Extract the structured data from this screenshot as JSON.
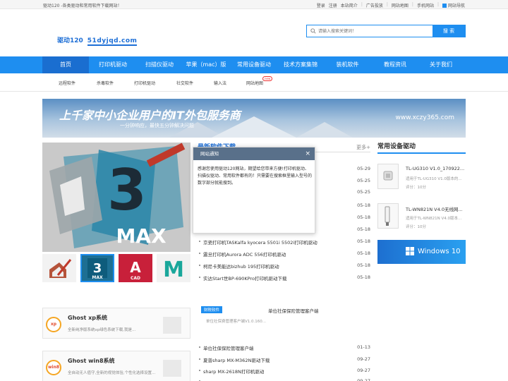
{
  "topbar": {
    "slogan": "驱动120 -各类驱动和常用软件下载网站！",
    "login": "登录",
    "register": "注册",
    "about": "本站简介",
    "ads": "广告投放",
    "sitemap": "网站地图",
    "mobile": "手机网站",
    "site_nav": "网站导航"
  },
  "logo": {
    "cn": "驱动120",
    "domain": "51dyjqd.com"
  },
  "search": {
    "placeholder": "请输入搜索关键词！",
    "button": "搜 索"
  },
  "nav": [
    "首页",
    "打印机驱动",
    "扫描仪驱动",
    "苹果（mac）版",
    "常用设备驱动",
    "技术方案集锦",
    "装机软件",
    "教程资讯",
    "关于我们"
  ],
  "subnav": {
    "items": [
      "远程软件",
      "杀毒软件",
      "打印机驱动",
      "社交软件",
      "输入法",
      "网站地图"
    ],
    "new_badge": "new"
  },
  "banner": {
    "title": "上千家中小企业用户的IT外包服务商",
    "subtitle": "一分钟响应，最快五分钟解决问题",
    "url": "www.xczy365.com"
  },
  "bigpic": {
    "label": "MAX"
  },
  "thumbs": [
    {
      "name": "sketchup"
    },
    {
      "name": "3dsmax",
      "t1": "3",
      "t2": "MAX"
    },
    {
      "name": "autocad",
      "t1": "A",
      "t2": "CAD"
    },
    {
      "name": "maya",
      "t1": "M"
    }
  ],
  "latest": {
    "title": "最新软件下载",
    "more": "更多+",
    "rows": [
      {
        "name": "",
        "date": "05-29"
      },
      {
        "name": "",
        "date": "05-25"
      },
      {
        "name": "",
        "date": "05-25"
      },
      {
        "name": "",
        "date": "05-18"
      },
      {
        "name": "",
        "date": "05-18"
      },
      {
        "name": "",
        "date": "05-18"
      },
      {
        "name": "京瓷打印机TASKalfa kyocera 5501i 5502i打印机驱动",
        "date": "05-18"
      },
      {
        "name": "震旦打印机Aurora ADC 556打印机驱动",
        "date": "05-18"
      },
      {
        "name": "柯尼卡美能达bizhub 195打印机驱动",
        "date": "05-18"
      },
      {
        "name": "实达Start世BP-690KPro打印机驱动下载",
        "date": "05-18"
      }
    ]
  },
  "modal": {
    "title": "网站通知",
    "body": "感谢您使用驱动120网站，期望给您带来方便!打印机驱动、扫描仪驱动、常用软件都有的！只需要在搜索框里输入型号的数字部分就能搜到。"
  },
  "right": {
    "title": "常用设备驱动",
    "cards": [
      {
        "title": "TL-UG310 V1.0_170922...",
        "desc": "适用于TL-UG310 V1.0版本的...",
        "score": "评分：10分"
      },
      {
        "title": "TL-WN821N V4.0无线网...",
        "desc": "适用于TL-WN821N V4.0版本...",
        "score": "评分：10分"
      }
    ],
    "promo": "Windows 10"
  },
  "ghost": [
    {
      "icon": "xp",
      "title": "Ghost xp系统",
      "desc": "全新纯净版系统xp绿色系统下载,我是..."
    },
    {
      "icon": "win8",
      "title": "Ghost win8系统",
      "desc": "全自动无人值守,全新的视觉体验,个性化选择设置..."
    }
  ],
  "feature": {
    "tag": "财税软件",
    "title": "单位社保保险管理客户端",
    "desc": "单位社保费管理客户端V1.0.160..."
  },
  "latest2": {
    "rows": [
      {
        "name": "单位社保保险管理客户端",
        "date": "01-13"
      },
      {
        "name": "夏普sharp MX-M362N驱动下载",
        "date": "09-27"
      },
      {
        "name": "sharp MX-2618N打印机驱动",
        "date": "09-27"
      },
      {
        "name": "",
        "date": "09-27"
      }
    ]
  },
  "colors": {
    "accent": "#1e8ef0",
    "nav_active": "#1a6ed0",
    "modal_header": "#59708a"
  }
}
